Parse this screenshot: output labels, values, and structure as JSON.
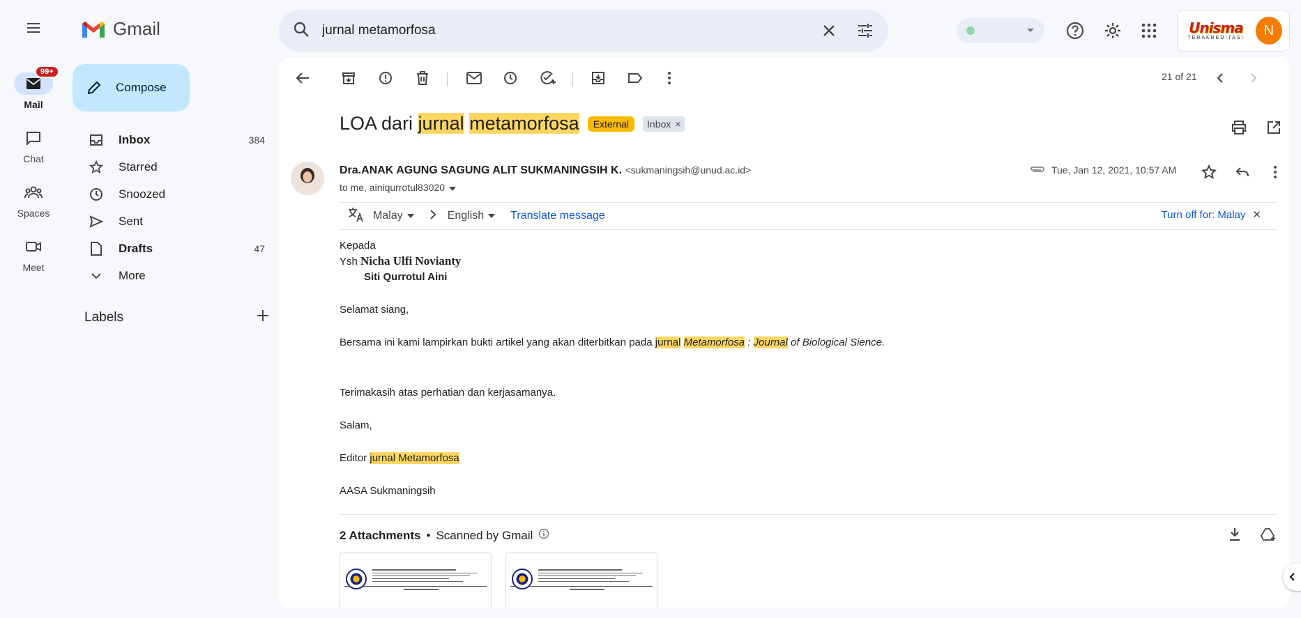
{
  "app": {
    "name": "Gmail"
  },
  "rail": {
    "items": [
      {
        "label": "Mail",
        "badge": "99+"
      },
      {
        "label": "Chat"
      },
      {
        "label": "Spaces"
      },
      {
        "label": "Meet"
      }
    ]
  },
  "compose_label": "Compose",
  "nav": [
    {
      "label": "Inbox",
      "count": "384"
    },
    {
      "label": "Starred",
      "count": ""
    },
    {
      "label": "Snoozed",
      "count": ""
    },
    {
      "label": "Sent",
      "count": ""
    },
    {
      "label": "Drafts",
      "count": "47"
    },
    {
      "label": "More",
      "count": ""
    }
  ],
  "labels_heading": "Labels",
  "search": {
    "value": "jurnal metamorfosa"
  },
  "account": {
    "initial": "N",
    "org_logo_text": "Unisma",
    "org_logo_sub": "TERAKREDITASI"
  },
  "toolbar": {
    "pager": "21 of 21"
  },
  "email": {
    "subject_parts": [
      "LOA dari ",
      "jurnal",
      " ",
      "metamorfosa"
    ],
    "tag_external": "External",
    "tag_inbox": "Inbox",
    "sender_name": "Dra.ANAK AGUNG SAGUNG ALIT SUKMANINGSIH K.",
    "sender_email": "<sukmaningsih@unud.ac.id>",
    "to_line": "to me, ainiqurrotul83020",
    "date": "Tue, Jan 12, 2021, 10:57 AM",
    "translate": {
      "from": "Malay",
      "to": "English",
      "action": "Translate message",
      "turn_off": "Turn off for: Malay"
    },
    "body": {
      "greeting": "Kepada",
      "ysh": "Ysh",
      "recipient1": "Nicha Ulfi Novianty",
      "recipient2": "Siti Qurrotul Aini",
      "salutation": "Selamat siang,",
      "para_pre": "Bersama ini kami lampirkan bukti artikel yang akan diterbitkan pada ",
      "para_hl1": "jurnal",
      "para_sp1": " ",
      "para_hl2": "Metamorfosa",
      "para_sep": " : ",
      "para_hl3": "Journal",
      "para_post": " of Biological Sience.",
      "thanks": "Terimakasih atas perhatian dan kerjasamanya.",
      "closing": "Salam,",
      "editor_pre": "Editor ",
      "editor_hl1": "jurnal",
      "editor_sp": " ",
      "editor_hl2": "Metamorfosa",
      "signature": "AASA Sukmaningsih"
    },
    "attachments": {
      "count_label": "2 Attachments",
      "dot": "•",
      "scanned": "Scanned by Gmail"
    }
  },
  "colors": {
    "accent": "#0b57d0",
    "highlight": "#fdd663",
    "external_tag": "#f9ba00",
    "compose_bg": "#c2e7ff"
  }
}
